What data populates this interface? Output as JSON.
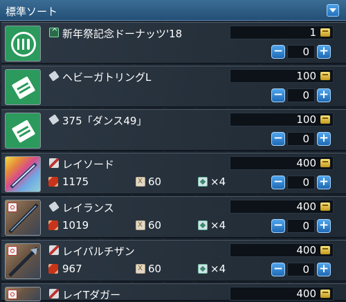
{
  "header": {
    "sort_label": "標準ソート"
  },
  "items": [
    {
      "name": "新年祭記念ドーナッツ'18",
      "price": "1",
      "quantity": "0",
      "type_icon": "rare-icon",
      "thumb": "food-icon"
    },
    {
      "name": "ヘビーガトリングL",
      "price": "100",
      "quantity": "0",
      "type_icon": "tag-icon",
      "thumb": "ticket-icon"
    },
    {
      "name": "375「ダンス49」",
      "price": "100",
      "quantity": "0",
      "type_icon": "tag-icon",
      "thumb": "ticket-icon"
    },
    {
      "name": "レイソード",
      "price": "400",
      "quantity": "0",
      "type_icon": "sword-icon",
      "thumb": "sword-weapon-icon",
      "attack": "1175",
      "requirement": "60",
      "slots": "×4"
    },
    {
      "name": "レイランス",
      "price": "400",
      "quantity": "0",
      "type_icon": "lance-icon",
      "thumb": "lance-weapon-icon",
      "attack": "1019",
      "requirement": "60",
      "slots": "×4"
    },
    {
      "name": "レイパルチザン",
      "price": "400",
      "quantity": "0",
      "type_icon": "partisan-icon",
      "thumb": "partisan-weapon-icon",
      "attack": "967",
      "requirement": "60",
      "slots": "×4"
    },
    {
      "name": "レイTダガー",
      "price": "400",
      "type_icon": "dagger-icon",
      "thumb": "dagger-weapon-icon"
    }
  ],
  "colors": {
    "header": "#2b5a82",
    "button": "#2f82d0",
    "thumb_green": "#2b9a5c"
  }
}
